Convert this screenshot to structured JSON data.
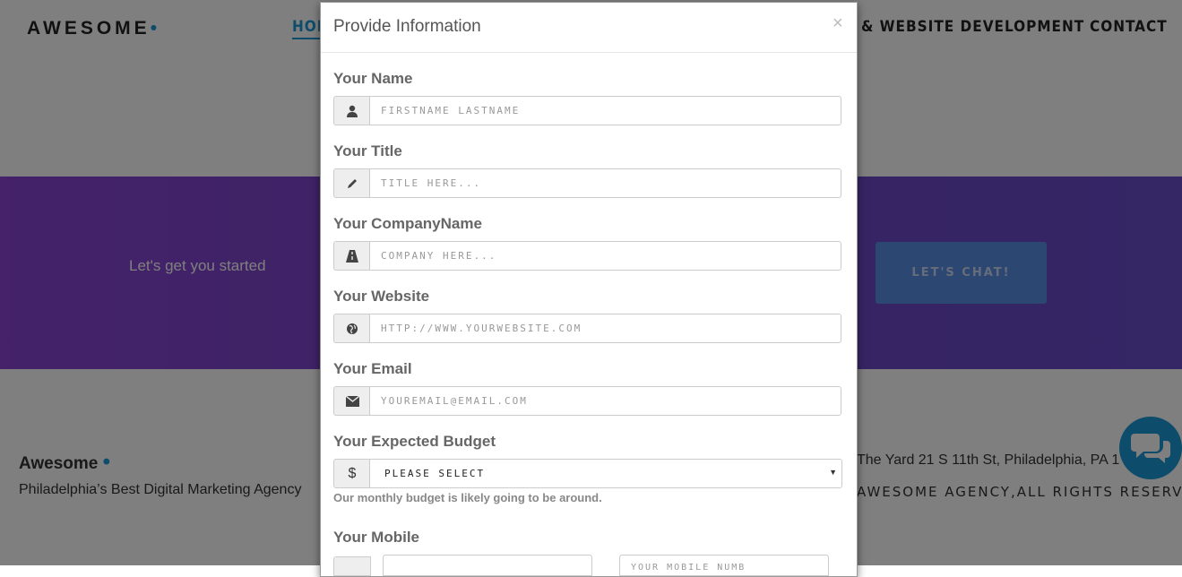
{
  "header": {
    "logo": "AWESOME",
    "logo_dot": "•",
    "nav": {
      "home": "HOM",
      "web": "& WEBSITE DEVELOPMENT",
      "contact": "CONTACT"
    }
  },
  "hero": {
    "cta_text": "Let's get you started",
    "cta_button": "LET'S CHAT!"
  },
  "footer": {
    "brand": "Awesome",
    "brand_dot": "•",
    "tagline": "Philadelphia’s Best Digital Marketing Agency",
    "address": "The Yard 21 S 11th St, Philadelphia, PA 1",
    "rights": "AWESOME AGENCY,ALL RIGHTS RESERVED"
  },
  "chat": {
    "icon": "chat-bubbles-icon"
  },
  "modal": {
    "title": "Provide Information",
    "close": "×",
    "fields": {
      "name": {
        "label": "Your Name",
        "placeholder": "FIRSTNAME LASTNAME",
        "icon": "user-icon"
      },
      "title": {
        "label": "Your Title",
        "placeholder": "TITLE HERE...",
        "icon": "pencil-icon"
      },
      "company": {
        "label": "Your CompanyName",
        "placeholder": "COMPANY HERE...",
        "icon": "road-icon"
      },
      "website": {
        "label": "Your Website",
        "placeholder": "HTTP://WWW.YOURWEBSITE.COM",
        "icon": "globe-icon"
      },
      "email": {
        "label": "Your Email",
        "placeholder": "YOUREMAIL@EMAIL.COM",
        "icon": "envelope-icon"
      }
    },
    "budget": {
      "label": "Your Expected Budget",
      "icon": "dollar-icon",
      "addon_symbol": "$",
      "selected": "PLEASE SELECT",
      "help": "Our monthly budget is likely going to be around."
    },
    "mobile": {
      "label": "Your Mobile",
      "icon": "mobile-phone-icon",
      "placeholder_partial": "YOUR MOBILE NUMB"
    }
  },
  "colors": {
    "accent": "#1a9bd7",
    "purple": "#7346c8",
    "cta_button": "#5b8fe6",
    "overlay": "rgba(0,0,0,0.5)"
  }
}
